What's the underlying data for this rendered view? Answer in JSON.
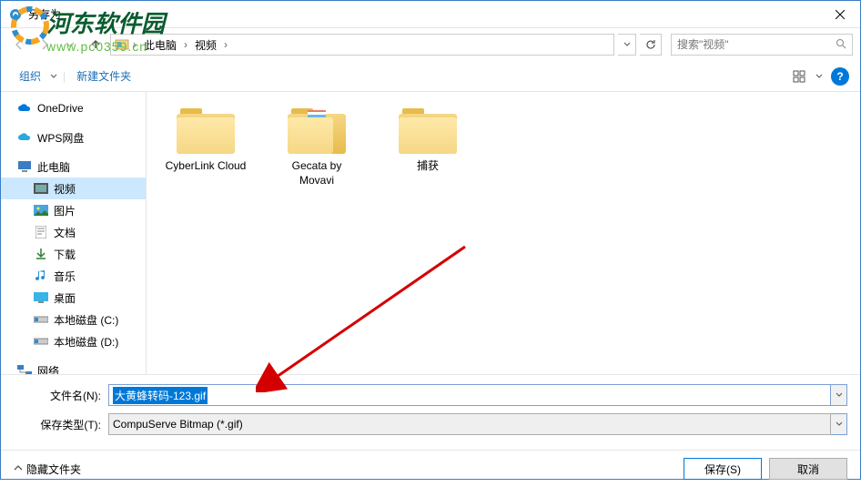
{
  "window": {
    "title": "另存为"
  },
  "breadcrumb": {
    "root": "此电脑",
    "current": "视频"
  },
  "search": {
    "placeholder": "搜索\"视频\""
  },
  "toolbar": {
    "organize": "组织",
    "new_folder": "新建文件夹"
  },
  "sidebar": {
    "onedrive": "OneDrive",
    "wps": "WPS网盘",
    "this_pc": "此电脑",
    "videos": "视频",
    "pictures": "图片",
    "documents": "文档",
    "downloads": "下载",
    "music": "音乐",
    "desktop": "桌面",
    "disk_c": "本地磁盘 (C:)",
    "disk_d": "本地磁盘 (D:)",
    "network": "网络"
  },
  "folders": [
    {
      "name": "CyberLink Cloud",
      "type": "plain"
    },
    {
      "name": "Gecata by Movavi",
      "type": "stripes"
    },
    {
      "name": "捕获",
      "type": "plain"
    }
  ],
  "fields": {
    "filename_label": "文件名(N):",
    "filename_value": "大黄蜂转码-123.gif",
    "filetype_label": "保存类型(T):",
    "filetype_value": "CompuServe Bitmap (*.gif)"
  },
  "footer": {
    "hide_folders": "隐藏文件夹",
    "save": "保存(S)",
    "cancel": "取消"
  },
  "watermark": {
    "text": "河东软件园",
    "url": "www.pc0359.cn"
  }
}
